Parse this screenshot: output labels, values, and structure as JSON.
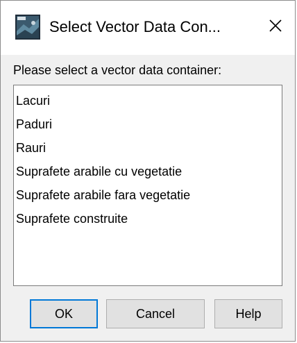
{
  "window": {
    "title": "Select Vector Data Con...",
    "app_icon": "snap-app-icon",
    "close_icon": "close-icon"
  },
  "prompt": "Please select a vector data container:",
  "list": {
    "items": [
      "Lacuri",
      "Paduri",
      "Rauri",
      "Suprafete arabile cu vegetatie",
      "Suprafete arabile fara vegetatie",
      "Suprafete construite"
    ]
  },
  "buttons": {
    "ok": "OK",
    "cancel": "Cancel",
    "help": "Help"
  },
  "colors": {
    "default_button_border": "#0078d7",
    "dialog_background": "#f0f0f0"
  }
}
